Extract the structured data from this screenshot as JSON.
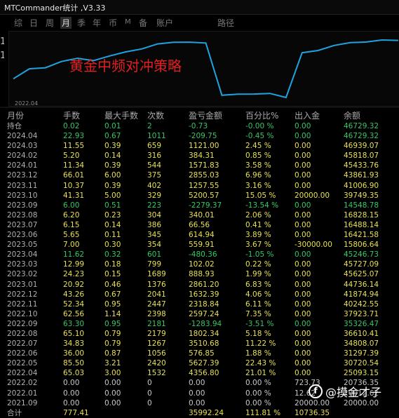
{
  "window": {
    "title": "MTCommander统计 ,V3.33"
  },
  "tabs": [
    {
      "label": "综",
      "active": false,
      "small": false
    },
    {
      "label": "日",
      "active": false,
      "small": false
    },
    {
      "label": "周",
      "active": false,
      "small": false
    },
    {
      "label": "月",
      "active": true,
      "small": false
    },
    {
      "label": "季",
      "active": false,
      "small": false
    },
    {
      "label": "年",
      "active": false,
      "small": false
    },
    {
      "label": "币",
      "active": false,
      "small": false
    },
    {
      "label": "M",
      "active": false,
      "small": true
    },
    {
      "label": "备",
      "active": false,
      "small": false
    },
    {
      "label": "账户",
      "active": false,
      "small": false
    },
    {
      "label": "路径",
      "active": false,
      "small": false
    }
  ],
  "chart": {
    "strategy_label": "黄金中频对冲策略",
    "x_start_label": "2022.04",
    "line_color": "#1fa3e0"
  },
  "colors": {
    "yellow": "#e8e050",
    "green": "#34c766",
    "white": "#c8c8c8"
  },
  "table": {
    "headers": [
      "月份",
      "手数",
      "最大手数",
      "次数",
      "盈亏金额",
      "百分比%",
      "出入金",
      "余额"
    ],
    "rows": [
      [
        "持仓",
        "0.02",
        "0.01",
        "2",
        "-0.73",
        "-0.00 %",
        "0.00",
        "46729.32"
      ],
      [
        "2024.04",
        "22.93",
        "0.67",
        "1011",
        "-209.75",
        "-0.45 %",
        "0.00",
        "46729.32"
      ],
      [
        "2024.03",
        "11.55",
        "0.39",
        "659",
        "1121.00",
        "2.45 %",
        "0.00",
        "46939.07"
      ],
      [
        "2024.02",
        "5.20",
        "0.14",
        "316",
        "384.31",
        "0.85 %",
        "0.00",
        "45818.07"
      ],
      [
        "2024.01",
        "11.34",
        "0.39",
        "544",
        "1571.83",
        "3.58 %",
        "0.00",
        "45433.76"
      ],
      [
        "2023.12",
        "66.01",
        "6.00",
        "375",
        "2855.03",
        "6.96 %",
        "0.00",
        "43861.93"
      ],
      [
        "2023.11",
        "10.37",
        "0.39",
        "402",
        "1257.55",
        "3.16 %",
        "0.00",
        "41006.90"
      ],
      [
        "2023.10",
        "41.31",
        "5.00",
        "329",
        "5200.57",
        "15.05 %",
        "20000.00",
        "39749.35"
      ],
      [
        "2023.09",
        "6.00",
        "0.51",
        "223",
        "-2279.37",
        "-13.54 %",
        "0.00",
        "14548.78"
      ],
      [
        "2023.08",
        "6.20",
        "0.23",
        "304",
        "340.01",
        "2.06 %",
        "0.00",
        "16828.15"
      ],
      [
        "2023.07",
        "6.15",
        "0.14",
        "386",
        "66.56",
        "0.41 %",
        "0.00",
        "16488.14"
      ],
      [
        "2023.06",
        "5.65",
        "0.11",
        "345",
        "614.94",
        "3.89 %",
        "0.00",
        "16421.58"
      ],
      [
        "2023.05",
        "7.00",
        "0.30",
        "354",
        "559.91",
        "3.67 %",
        "-30000.00",
        "15806.64"
      ],
      [
        "2023.04",
        "11.62",
        "0.32",
        "601",
        "-480.36",
        "-1.05 %",
        "0.00",
        "45246.73"
      ],
      [
        "2023.03",
        "12.99",
        "0.18",
        "799",
        "102.02",
        "0.22 %",
        "0.00",
        "45727.09"
      ],
      [
        "2023.02",
        "24.23",
        "0.15",
        "1689",
        "888.93",
        "1.99 %",
        "0.00",
        "45625.07"
      ],
      [
        "2023.01",
        "20.92",
        "0.46",
        "1376",
        "2861.20",
        "6.83 %",
        "0.00",
        "44736.14"
      ],
      [
        "2022.12",
        "43.26",
        "0.67",
        "2041",
        "1632.39",
        "4.06 %",
        "0.00",
        "41874.94"
      ],
      [
        "2022.11",
        "52.34",
        "0.95",
        "2447",
        "2318.84",
        "6.11 %",
        "0.00",
        "40242.55"
      ],
      [
        "2022.10",
        "62.56",
        "1.14",
        "2398",
        "2597.24",
        "7.35 %",
        "0.00",
        "37923.71"
      ],
      [
        "2022.09",
        "63.30",
        "0.95",
        "2181",
        "-1283.94",
        "-3.51 %",
        "0.00",
        "35326.47"
      ],
      [
        "2022.08",
        "65.10",
        "0.79",
        "2179",
        "1802.34",
        "5.18 %",
        "0.00",
        "36610.41"
      ],
      [
        "2022.07",
        "34.83",
        "0.79",
        "1267",
        "3510.68",
        "11.22 %",
        "0.00",
        "34808.07"
      ],
      [
        "2022.06",
        "36.00",
        "0.87",
        "1056",
        "576.85",
        "1.88 %",
        "0.00",
        "31297.39"
      ],
      [
        "2022.05",
        "85.50",
        "3.21",
        "2420",
        "5627.39",
        "22.43 %",
        "0.00",
        "30720.54"
      ],
      [
        "2022.04",
        "65.03",
        "3.00",
        "1532",
        "4356.80",
        "21.01 %",
        "0.00",
        "25093.15"
      ],
      [
        "2022.02",
        "0.00",
        "0.00",
        "0",
        "0.00",
        "0.00 %",
        "723.73",
        "20736.35"
      ],
      [
        "2022.01",
        "0.00",
        "0.00",
        "0",
        "0.00",
        "0.00 %",
        "12.62",
        "20012.62"
      ],
      [
        "2021.09",
        "0.00",
        "0.00",
        "0",
        "0.00",
        "0.00 %",
        "20000.00",
        "20000.00"
      ]
    ],
    "row_colors": [
      "g",
      "g",
      "y",
      "y",
      "y",
      "y",
      "y",
      "y",
      "g",
      "y",
      "y",
      "y",
      "y",
      "g",
      "y",
      "y",
      "y",
      "y",
      "y",
      "y",
      "g",
      "y",
      "y",
      "y",
      "y",
      "y",
      "w",
      "w",
      "w"
    ],
    "footer": [
      "合计",
      "777.41",
      "",
      "",
      "35992.24",
      "111.81 %",
      "10736.35",
      ""
    ]
  },
  "watermark": {
    "icon_letter": "f",
    "text": "@摸金才子"
  }
}
